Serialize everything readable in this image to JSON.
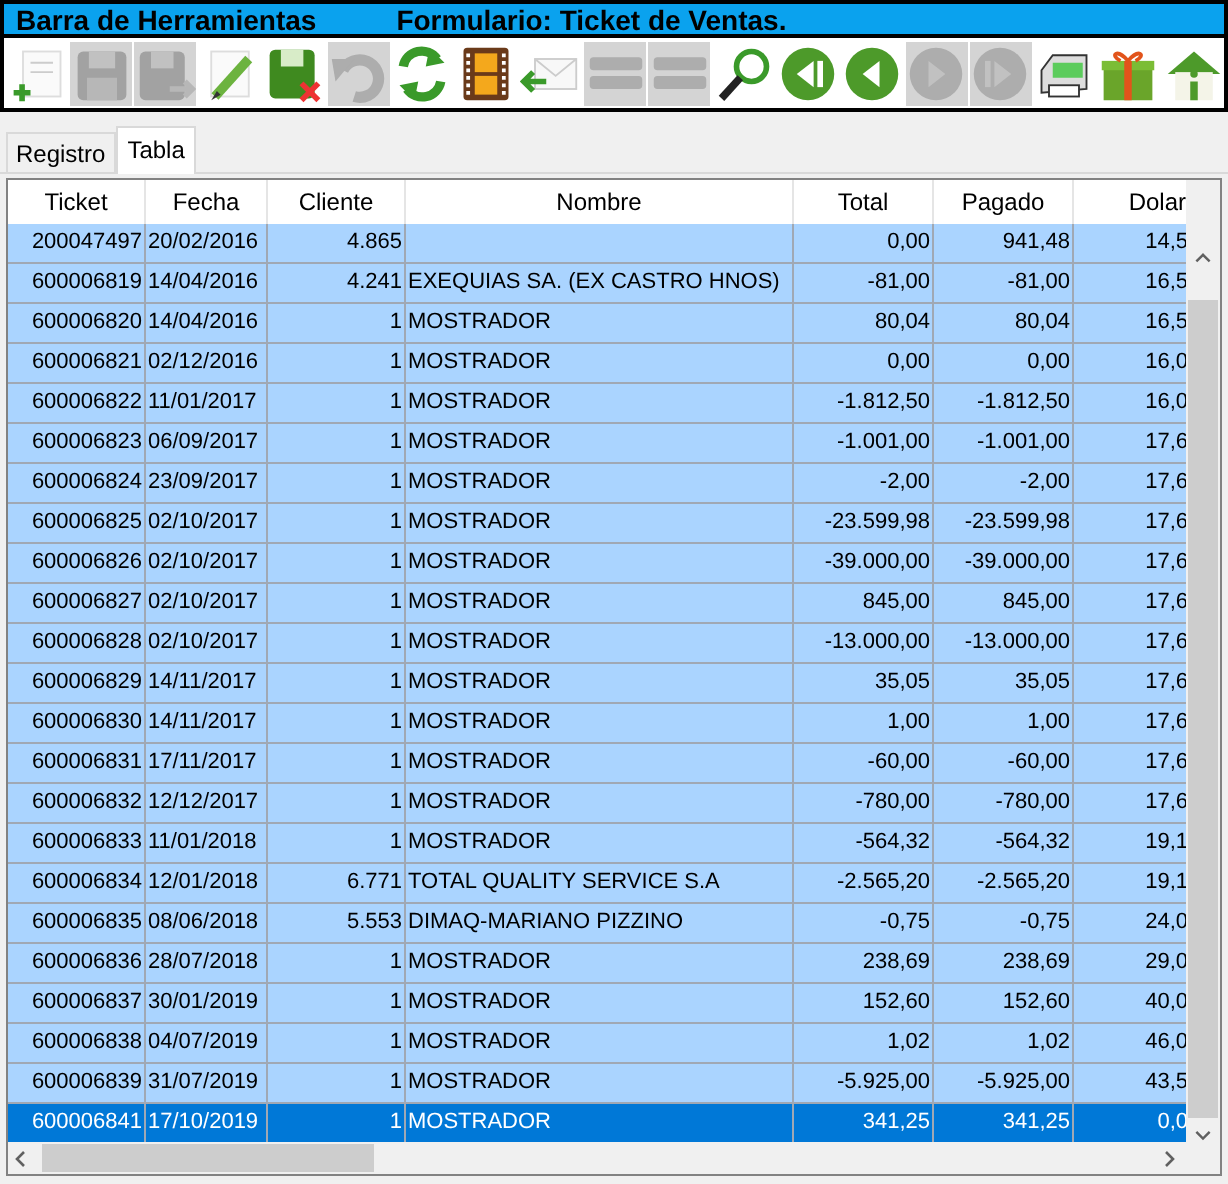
{
  "window": {
    "title": "Barra de Herramientas",
    "form_title": "Formulario: Ticket de Ventas."
  },
  "toolbar": [
    {
      "kind": "new",
      "disabled": false
    },
    {
      "kind": "save",
      "disabled": true
    },
    {
      "kind": "saveas",
      "disabled": true
    },
    {
      "kind": "edit",
      "disabled": false
    },
    {
      "kind": "cancel",
      "disabled": false
    },
    {
      "kind": "undo",
      "disabled": true
    },
    {
      "kind": "refresh",
      "disabled": false
    },
    {
      "kind": "film",
      "disabled": false
    },
    {
      "kind": "mail",
      "disabled": false
    },
    {
      "kind": "bars",
      "disabled": true
    },
    {
      "kind": "bars",
      "disabled": true
    },
    {
      "kind": "search",
      "disabled": false
    },
    {
      "kind": "first",
      "disabled": false
    },
    {
      "kind": "prev",
      "disabled": false
    },
    {
      "kind": "next",
      "disabled": true
    },
    {
      "kind": "last",
      "disabled": true
    },
    {
      "kind": "print",
      "disabled": false
    },
    {
      "kind": "gift",
      "disabled": false
    },
    {
      "kind": "home",
      "disabled": false
    }
  ],
  "tabs": [
    {
      "label": "Registro",
      "selected": false
    },
    {
      "label": "Tabla",
      "selected": true
    }
  ],
  "table": {
    "columns": [
      "Ticket",
      "Fecha",
      "Cliente",
      "Nombre",
      "Total",
      "Pagado",
      "Dolar"
    ],
    "rows": [
      {
        "cells": [
          "200047497",
          "20/02/2016",
          "4.865",
          "",
          "0,00",
          "941,48",
          "14,5"
        ],
        "selected": false
      },
      {
        "cells": [
          "600006819",
          "14/04/2016",
          "4.241",
          "EXEQUIAS SA. (EX CASTRO HNOS)",
          "-81,00",
          "-81,00",
          "16,5"
        ],
        "selected": false
      },
      {
        "cells": [
          "600006820",
          "14/04/2016",
          "1",
          "MOSTRADOR",
          "80,04",
          "80,04",
          "16,5"
        ],
        "selected": false
      },
      {
        "cells": [
          "600006821",
          "02/12/2016",
          "1",
          "MOSTRADOR",
          "0,00",
          "0,00",
          "16,0"
        ],
        "selected": false
      },
      {
        "cells": [
          "600006822",
          "11/01/2017",
          "1",
          "MOSTRADOR",
          "-1.812,50",
          "-1.812,50",
          "16,0"
        ],
        "selected": false
      },
      {
        "cells": [
          "600006823",
          "06/09/2017",
          "1",
          "MOSTRADOR",
          "-1.001,00",
          "-1.001,00",
          "17,6"
        ],
        "selected": false
      },
      {
        "cells": [
          "600006824",
          "23/09/2017",
          "1",
          "MOSTRADOR",
          "-2,00",
          "-2,00",
          "17,6"
        ],
        "selected": false
      },
      {
        "cells": [
          "600006825",
          "02/10/2017",
          "1",
          "MOSTRADOR",
          "-23.599,98",
          "-23.599,98",
          "17,6"
        ],
        "selected": false
      },
      {
        "cells": [
          "600006826",
          "02/10/2017",
          "1",
          "MOSTRADOR",
          "-39.000,00",
          "-39.000,00",
          "17,6"
        ],
        "selected": false
      },
      {
        "cells": [
          "600006827",
          "02/10/2017",
          "1",
          "MOSTRADOR",
          "845,00",
          "845,00",
          "17,6"
        ],
        "selected": false
      },
      {
        "cells": [
          "600006828",
          "02/10/2017",
          "1",
          "MOSTRADOR",
          "-13.000,00",
          "-13.000,00",
          "17,6"
        ],
        "selected": false
      },
      {
        "cells": [
          "600006829",
          "14/11/2017",
          "1",
          "MOSTRADOR",
          "35,05",
          "35,05",
          "17,6"
        ],
        "selected": false
      },
      {
        "cells": [
          "600006830",
          "14/11/2017",
          "1",
          "MOSTRADOR",
          "1,00",
          "1,00",
          "17,6"
        ],
        "selected": false
      },
      {
        "cells": [
          "600006831",
          "17/11/2017",
          "1",
          "MOSTRADOR",
          "-60,00",
          "-60,00",
          "17,6"
        ],
        "selected": false
      },
      {
        "cells": [
          "600006832",
          "12/12/2017",
          "1",
          "MOSTRADOR",
          "-780,00",
          "-780,00",
          "17,6"
        ],
        "selected": false
      },
      {
        "cells": [
          "600006833",
          "11/01/2018",
          "1",
          "MOSTRADOR",
          "-564,32",
          "-564,32",
          "19,1"
        ],
        "selected": false
      },
      {
        "cells": [
          "600006834",
          "12/01/2018",
          "6.771",
          "TOTAL QUALITY SERVICE S.A",
          "-2.565,20",
          "-2.565,20",
          "19,1"
        ],
        "selected": false
      },
      {
        "cells": [
          "600006835",
          "08/06/2018",
          "5.553",
          "DIMAQ-MARIANO  PIZZINO",
          "-0,75",
          "-0,75",
          "24,0"
        ],
        "selected": false
      },
      {
        "cells": [
          "600006836",
          "28/07/2018",
          "1",
          "MOSTRADOR",
          "238,69",
          "238,69",
          "29,0"
        ],
        "selected": false
      },
      {
        "cells": [
          "600006837",
          "30/01/2019",
          "1",
          "MOSTRADOR",
          "152,60",
          "152,60",
          "40,0"
        ],
        "selected": false
      },
      {
        "cells": [
          "600006838",
          "04/07/2019",
          "1",
          "MOSTRADOR",
          "1,02",
          "1,02",
          "46,0"
        ],
        "selected": false
      },
      {
        "cells": [
          "600006839",
          "31/07/2019",
          "1",
          "MOSTRADOR",
          "-5.925,00",
          "-5.925,00",
          "43,5"
        ],
        "selected": false
      },
      {
        "cells": [
          "600006841",
          "17/10/2019",
          "1",
          "MOSTRADOR",
          "341,25",
          "341,25",
          "0,0"
        ],
        "selected": true
      }
    ]
  }
}
